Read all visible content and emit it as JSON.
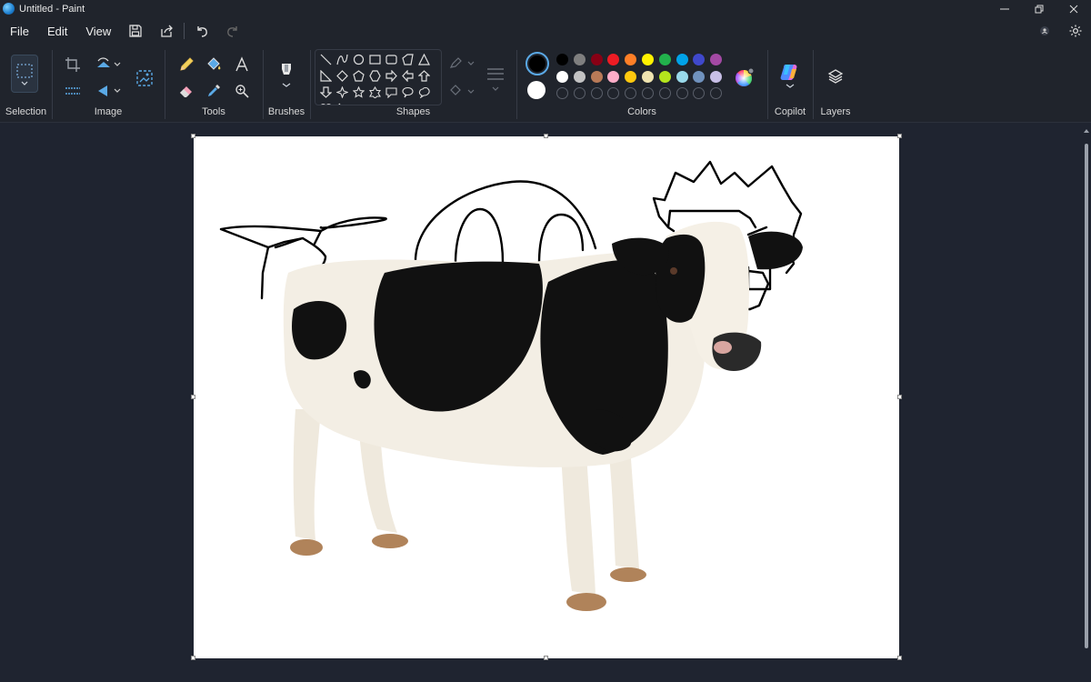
{
  "window": {
    "title": "Untitled - Paint"
  },
  "menu": {
    "file": "File",
    "edit": "Edit",
    "view": "View"
  },
  "ribbon": {
    "groups": {
      "selection": "Selection",
      "image": "Image",
      "tools": "Tools",
      "brushes": "Brushes",
      "shapes": "Shapes",
      "colors": "Colors",
      "copilot": "Copilot",
      "layers": "Layers"
    }
  },
  "colors": {
    "current_primary": "#000000",
    "current_secondary": "#ffffff",
    "palette_row1": [
      "#000000",
      "#7f7f7f",
      "#880015",
      "#ed1c24",
      "#ff7f27",
      "#fff200",
      "#22b14c",
      "#00a2e8",
      "#3f48cc",
      "#a349a4"
    ],
    "palette_row2": [
      "#ffffff",
      "#c3c3c3",
      "#b97a57",
      "#ffaec9",
      "#ffc90e",
      "#efe4b0",
      "#b5e61d",
      "#99d9ea",
      "#7092be",
      "#c8bfe7"
    ]
  },
  "icons": {
    "save": "save-icon",
    "share": "share-icon",
    "undo": "undo-icon",
    "redo": "redo-icon",
    "settings": "gear-icon",
    "account": "account-icon"
  }
}
